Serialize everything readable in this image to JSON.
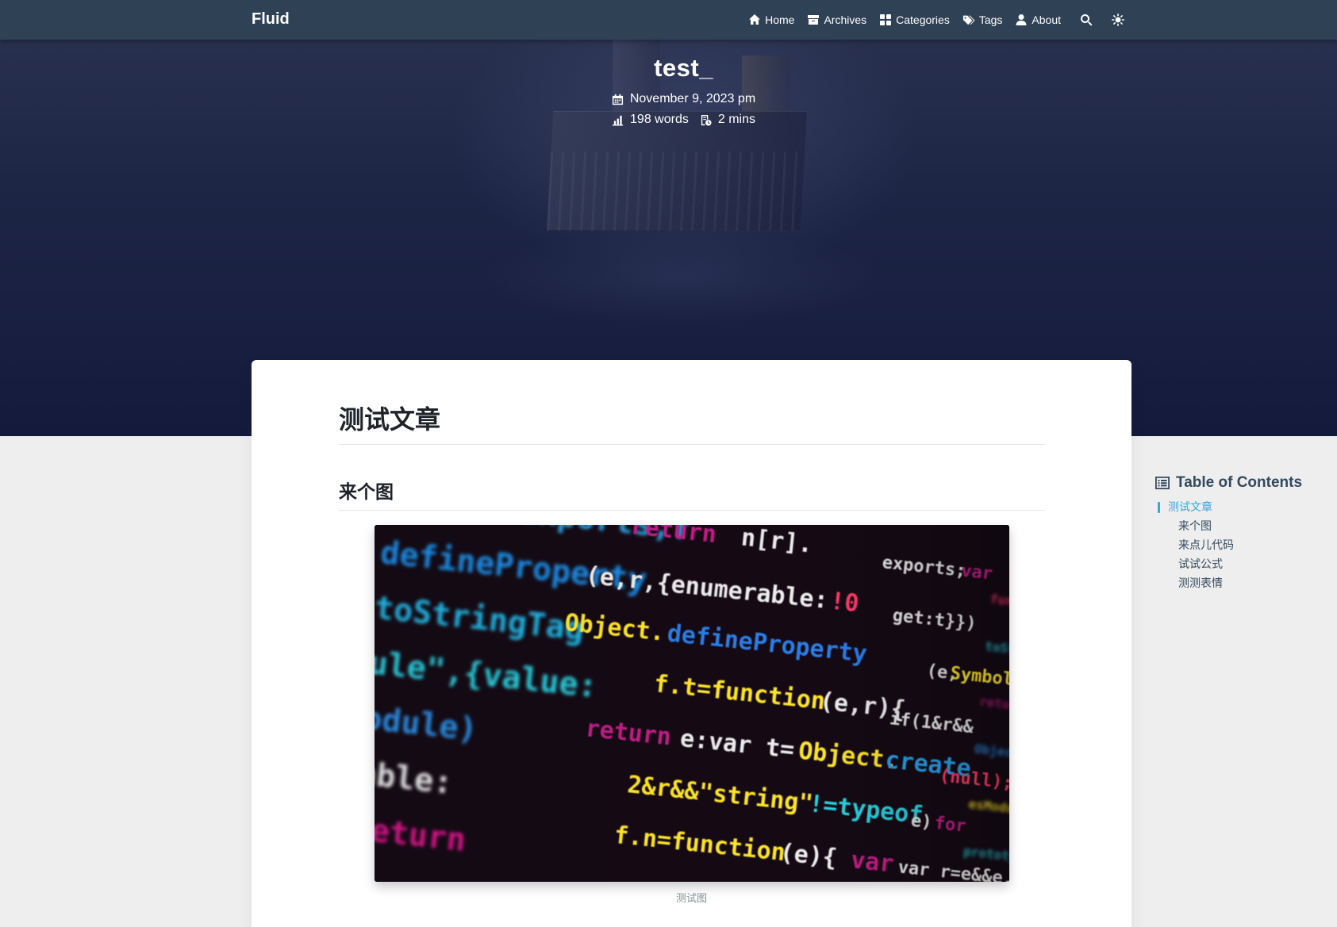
{
  "navbar": {
    "brand": "Fluid",
    "items": [
      {
        "label": "Home",
        "icon": "home-icon"
      },
      {
        "label": "Archives",
        "icon": "archive-icon"
      },
      {
        "label": "Categories",
        "icon": "categories-icon"
      },
      {
        "label": "Tags",
        "icon": "tags-icon"
      },
      {
        "label": "About",
        "icon": "user-icon"
      }
    ],
    "search_icon": "search-icon",
    "theme_icon": "sun-icon"
  },
  "banner": {
    "title": "test_",
    "date": "November 9, 2023 pm",
    "words": "198 words",
    "read_time": "2 mins"
  },
  "article": {
    "h1": "测试文章",
    "h2": "来个图",
    "image_caption": "测试图"
  },
  "toc": {
    "title": "Table of Contents",
    "items": [
      {
        "label": "测试文章",
        "level": 1,
        "active": true
      },
      {
        "label": "来个图",
        "level": 2,
        "active": false
      },
      {
        "label": "来点儿代码",
        "level": 2,
        "active": false
      },
      {
        "label": "试试公式",
        "level": 2,
        "active": false
      },
      {
        "label": "测测表情",
        "level": 2,
        "active": false
      }
    ]
  },
  "colors": {
    "navbar": "#2f4154",
    "accent": "#30a9de",
    "text": "#2c3e50",
    "background": "#eeeeee"
  }
}
